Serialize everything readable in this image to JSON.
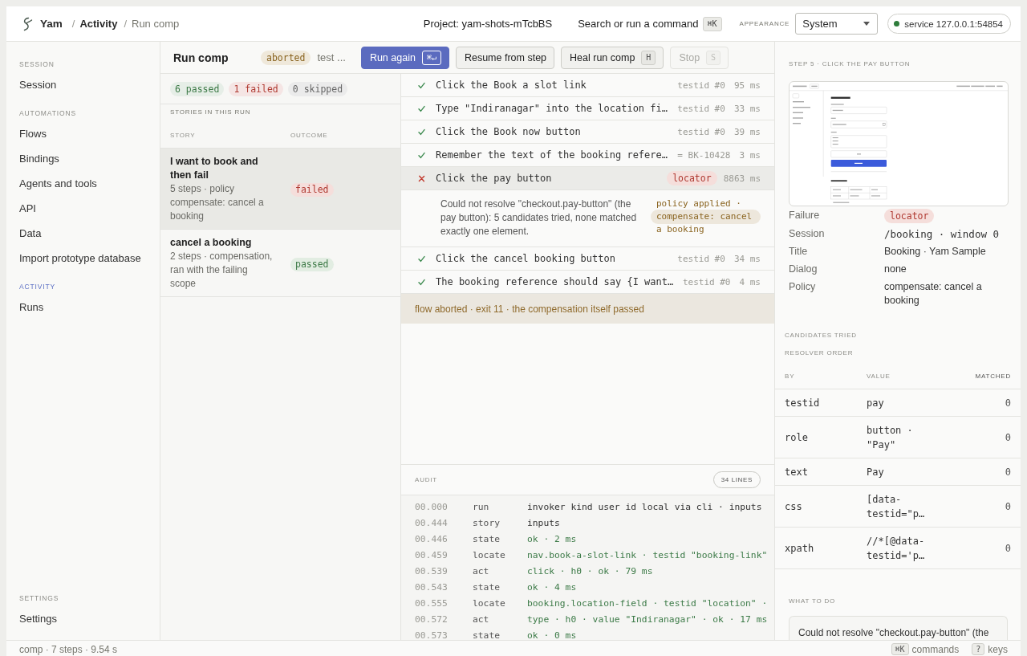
{
  "topbar": {
    "brand": "Yam",
    "breadcrumbs": [
      {
        "separator": "/",
        "label": "Activity",
        "current": false
      },
      {
        "separator": "/",
        "label": "Run comp",
        "current": true
      }
    ],
    "project": "Project: yam-shots-mTcbBS",
    "search": {
      "label": "Search or run a command",
      "shortcut": "⌘K"
    },
    "appearance": {
      "label": "APPEARANCE",
      "value": "System"
    },
    "service": {
      "label": "service 127.0.0.1:54854",
      "online": true
    }
  },
  "sidebar": {
    "sections": [
      {
        "heading": "SESSION",
        "active": false,
        "items": [
          {
            "label": "Session",
            "selected": false
          }
        ]
      },
      {
        "heading": "AUTOMATIONS",
        "active": false,
        "items": [
          {
            "label": "Flows",
            "selected": false
          },
          {
            "label": "Bindings",
            "selected": false
          },
          {
            "label": "Agents and tools",
            "selected": false
          },
          {
            "label": "API",
            "selected": false
          },
          {
            "label": "Data",
            "selected": false
          },
          {
            "label": "Import prototype database",
            "selected": false
          }
        ]
      },
      {
        "heading": "ACTIVITY",
        "active": true,
        "items": [
          {
            "label": "Runs",
            "selected": false
          }
        ]
      }
    ],
    "footer": {
      "heading": "SETTINGS",
      "active": false,
      "items": [
        {
          "label": "Settings",
          "selected": false
        }
      ]
    }
  },
  "run": {
    "title": "Run comp",
    "status": "aborted",
    "note": "test ...",
    "buttons": [
      {
        "kind": "primary",
        "label": "Run again",
        "shortcut": "⌘↵",
        "disabled": false
      },
      {
        "kind": "default",
        "label": "Resume from step",
        "disabled": false
      },
      {
        "kind": "default",
        "label": "Heal run comp",
        "shortcut": "H",
        "disabled": false
      },
      {
        "kind": "default",
        "label": "Stop",
        "shortcut": "S",
        "disabled": true
      }
    ]
  },
  "summary": [
    {
      "label": "6 passed",
      "color": "#3d7a47"
    },
    {
      "label": "1 failed",
      "color": "#b03a32"
    },
    {
      "label": "0 skipped",
      "color": "#666666"
    }
  ],
  "stories": {
    "caption": "STORIES IN THIS RUN",
    "columns": [
      "STORY",
      "OUTCOME"
    ],
    "rows": [
      {
        "title": "I want to book and then fail",
        "meta": "5 steps · policy compensate: cancel a booking",
        "outcome": "failed",
        "passed": false,
        "selected": true
      },
      {
        "title": "cancel a booking",
        "meta": "2 steps · compensation, ran with the failing scope",
        "outcome": "passed",
        "passed": true,
        "selected": false
      }
    ]
  },
  "steps": [
    {
      "passed": true,
      "text": "Click the Book a slot link",
      "meta": "testid #0",
      "duration": "95 ms",
      "selected": false
    },
    {
      "passed": true,
      "text": "Type \"Indiranagar\" into the location fi…",
      "meta": "testid #0",
      "duration": "33 ms",
      "selected": false
    },
    {
      "passed": true,
      "text": "Click the Book now button",
      "meta": "testid #0",
      "duration": "39 ms",
      "selected": false
    },
    {
      "passed": true,
      "text": "Remember the text of the booking refere…",
      "meta": "= BK-10428",
      "duration": "3 ms",
      "selected": false
    },
    {
      "passed": false,
      "text": "Click the pay button",
      "tag": "locator",
      "duration": "8863 ms",
      "selected": true,
      "error": "Could not resolve \"checkout.pay-button\" (the pay button): 5 candidates tried, none matched exactly one element.",
      "policy": "policy applied · compensate: cancel a booking"
    },
    {
      "passed": true,
      "text": "Click the cancel booking button",
      "meta": "testid #0",
      "duration": "34 ms",
      "selected": false
    },
    {
      "passed": true,
      "text": "The booking reference should say {I want…",
      "meta": "testid #0",
      "duration": "4 ms",
      "selected": false
    }
  ],
  "banner": "flow aborted · exit 11 · the compensation itself passed",
  "audit": {
    "caption": "AUDIT",
    "count": "34 LINES",
    "lines": [
      {
        "time": "00.000",
        "event": "run",
        "message": "invoker kind user id local via cli · inputs",
        "ok": false
      },
      {
        "time": "00.444",
        "event": "story",
        "message": "inputs",
        "ok": false
      },
      {
        "time": "00.446",
        "event": "state",
        "message": "ok · 2 ms",
        "ok": true
      },
      {
        "time": "00.459",
        "event": "locate",
        "message": "nav.book-a-slot-link · testid \"booking-link\"",
        "ok": true
      },
      {
        "time": "00.539",
        "event": "act",
        "message": "click · h0 · ok · 79 ms",
        "ok": true
      },
      {
        "time": "00.543",
        "event": "state",
        "message": "ok · 4 ms",
        "ok": true
      },
      {
        "time": "00.555",
        "event": "locate",
        "message": "booking.location-field · testid \"location\" ·",
        "ok": true
      },
      {
        "time": "00.572",
        "event": "act",
        "message": "type · h0 · value \"Indiranagar\" · ok · 17 ms",
        "ok": true
      },
      {
        "time": "00.573",
        "event": "state",
        "message": "ok · 0 ms",
        "ok": true
      }
    ]
  },
  "detail": {
    "caption": "STEP 5 · CLICK THE PAY BUTTON",
    "facts": [
      {
        "label": "Failure",
        "value": "locator",
        "kind": "tag"
      },
      {
        "label": "Session",
        "value": "/booking · window 0",
        "kind": "code"
      },
      {
        "label": "Title",
        "value": "Booking · Yam Sample",
        "kind": "text"
      },
      {
        "label": "Dialog",
        "value": "none",
        "kind": "text"
      },
      {
        "label": "Policy",
        "value": "compensate: cancel a booking",
        "kind": "text"
      }
    ],
    "candidates": {
      "caption": "CANDIDATES TRIED",
      "subcaption": "RESOLVER ORDER",
      "columns": [
        "BY",
        "VALUE",
        "MATCHED"
      ],
      "rows": [
        {
          "by": "testid",
          "value": "pay",
          "matched": "0"
        },
        {
          "by": "role",
          "value": "button · \"Pay\"",
          "matched": "0"
        },
        {
          "by": "text",
          "value": "Pay",
          "matched": "0"
        },
        {
          "by": "css",
          "value": "[data-testid=\"p…",
          "matched": "0"
        },
        {
          "by": "xpath",
          "value": "//*[@data-testid='p…",
          "matched": "0"
        }
      ]
    },
    "advice": {
      "caption": "WHAT TO DO",
      "text": "Could not resolve \"checkout.pay-button\" (the"
    }
  },
  "status_bar": {
    "summary": "comp · 7 steps · 9.54 s",
    "hints": [
      {
        "key": "⌘K",
        "label": "commands"
      },
      {
        "key": "?",
        "label": "keys"
      }
    ]
  }
}
